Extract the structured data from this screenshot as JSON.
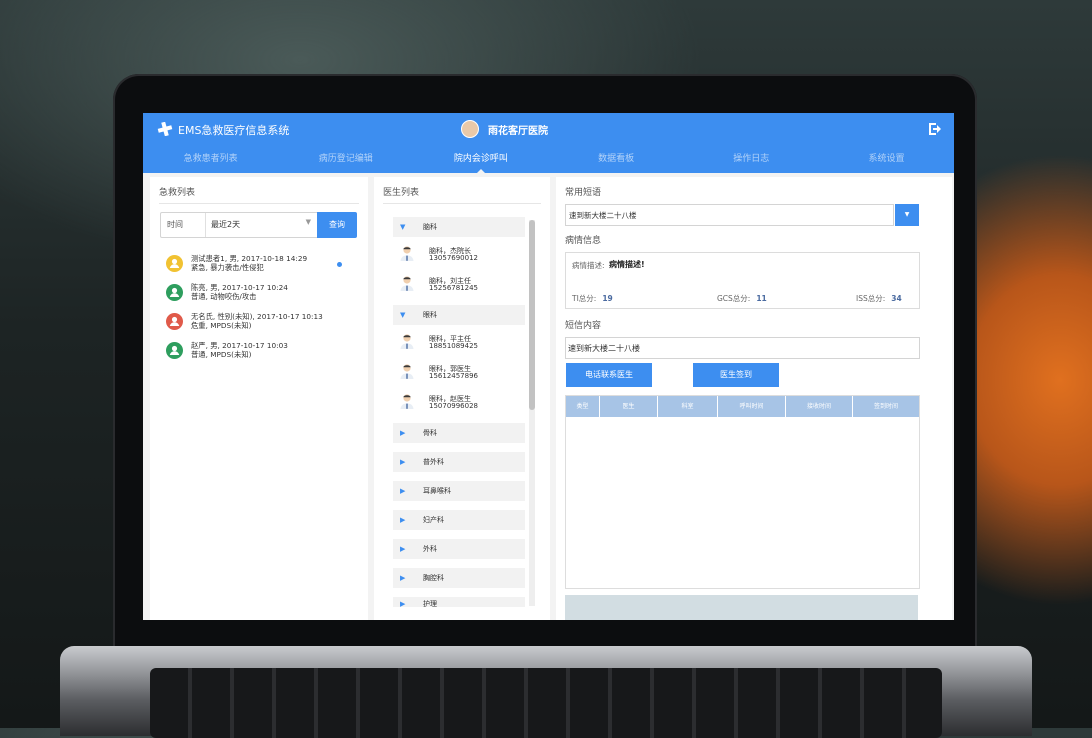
{
  "header": {
    "app_title": "EMS急救医疗信息系统",
    "hospital_name": "雨花客厅医院"
  },
  "nav": [
    {
      "label": "急救患者列表"
    },
    {
      "label": "病历登记编辑"
    },
    {
      "label": "院内会诊呼叫"
    },
    {
      "label": "数据看板"
    },
    {
      "label": "操作日志"
    },
    {
      "label": "系统设置"
    }
  ],
  "emergency": {
    "title": "急救列表",
    "filter_label": "时间",
    "filter_value": "最近2天",
    "query_label": "查询",
    "items": [
      {
        "line1": "测试患者1, 男, 2017-10-18 14:29",
        "line2": "紧急, 暴力袭击/性侵犯"
      },
      {
        "line1": "陈亮, 男, 2017-10-17 10:24",
        "line2": "普通, 动物咬伤/攻击"
      },
      {
        "line1": "无名氏, 性别(未知), 2017-10-17 10:13",
        "line2": "危重, MPDS(未知)"
      },
      {
        "line1": "赵严, 男, 2017-10-17 10:03",
        "line2": "普通, MPDS(未知)"
      }
    ]
  },
  "doctors": {
    "title": "医生列表",
    "dept1": "脑科",
    "dept1_docs": [
      {
        "n1": "脑科，杰院长",
        "n2": "13057690012"
      },
      {
        "n1": "脑科，刘主任",
        "n2": "15256781245"
      }
    ],
    "dept2": "眼科",
    "dept2_docs": [
      {
        "n1": "眼科，平主任",
        "n2": "18851089425"
      },
      {
        "n1": "眼科，郭医生",
        "n2": "15612457896"
      },
      {
        "n1": "眼科，赵医生",
        "n2": "15070996028"
      }
    ],
    "collapsed": [
      {
        "label": "骨科"
      },
      {
        "label": "普外科"
      },
      {
        "label": "耳鼻喉科"
      },
      {
        "label": "妇产科"
      },
      {
        "label": "外科"
      },
      {
        "label": "胸腔科"
      },
      {
        "label": "护理"
      }
    ]
  },
  "right": {
    "phrases_title": "常用短语",
    "phrase_selected": "速到新大楼二十八楼",
    "info_title": "病情信息",
    "desc_label": "病情描述:",
    "desc_value": "病情描述!",
    "ti_label": "TI总分:",
    "ti_value": "19",
    "gcs_label": "GCS总分:",
    "gcs_value": "11",
    "iss_label": "ISS总分:",
    "iss_value": "34",
    "sms_title": "短信内容",
    "sms_value": "速到新大楼二十八楼",
    "call_btn": "电话联系医生",
    "sign_btn": "医生签到",
    "table_headers": [
      "类型",
      "医生",
      "科室",
      "呼叫时间",
      "接收时间",
      "签到时间"
    ]
  },
  "colors": {
    "primary": "#3d8ef0",
    "urgent": "#f1c232",
    "normal": "#2e9e5e",
    "critical": "#e05a4a"
  }
}
